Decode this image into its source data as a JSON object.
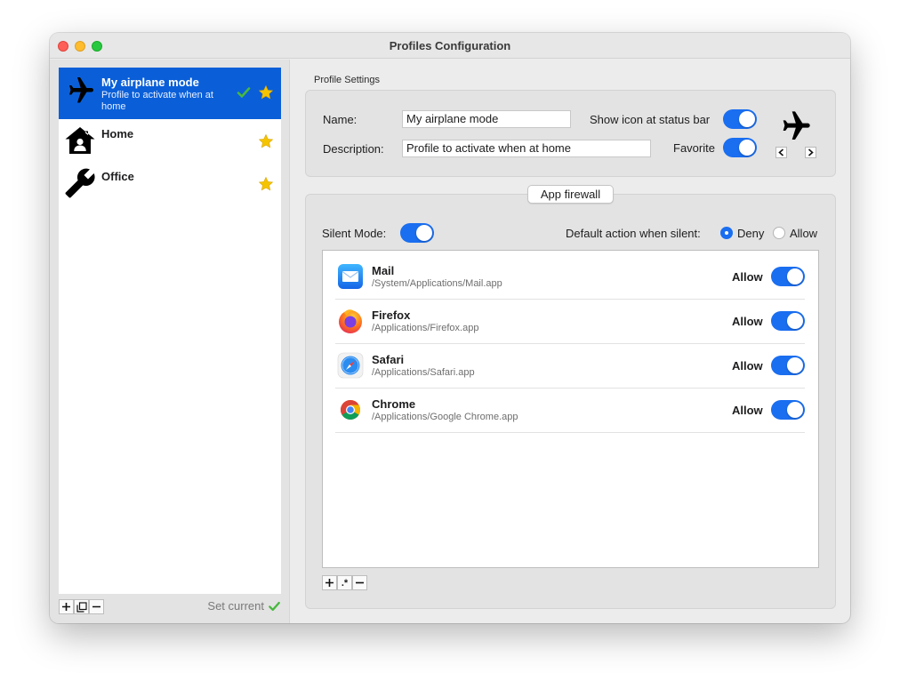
{
  "window": {
    "title": "Profiles Configuration"
  },
  "sidebar": {
    "profiles": [
      {
        "name": "My airplane mode",
        "description": "Profile to activate when at home",
        "icon": "airplane-icon",
        "selected": true,
        "current": true,
        "favorite": true
      },
      {
        "name": "Home",
        "description": "",
        "icon": "home-icon",
        "selected": false,
        "current": false,
        "favorite": true
      },
      {
        "name": "Office",
        "description": "",
        "icon": "wrench-icon",
        "selected": false,
        "current": false,
        "favorite": true
      }
    ],
    "footer": {
      "add": "+",
      "duplicate": "duplicate-icon",
      "remove": "−",
      "set_current": "Set current"
    }
  },
  "settings": {
    "group_label": "Profile Settings",
    "name_label": "Name:",
    "name_value": "My airplane mode",
    "description_label": "Description:",
    "description_value": "Profile to activate when at home",
    "show_icon_label": "Show icon at status bar",
    "show_icon_on": true,
    "favorite_label": "Favorite",
    "favorite_on": true,
    "icon": "airplane-icon"
  },
  "firewall": {
    "tab_label": "App firewall",
    "silent_label": "Silent Mode:",
    "silent_on": true,
    "default_action_label": "Default action when silent:",
    "deny_label": "Deny",
    "allow_label": "Allow",
    "default_action": "Deny",
    "apps": [
      {
        "name": "Mail",
        "path": "/System/Applications/Mail.app",
        "action": "Allow",
        "enabled": true,
        "icon": "mail-app-icon"
      },
      {
        "name": "Firefox",
        "path": "/Applications/Firefox.app",
        "action": "Allow",
        "enabled": true,
        "icon": "firefox-app-icon"
      },
      {
        "name": "Safari",
        "path": "/Applications/Safari.app",
        "action": "Allow",
        "enabled": true,
        "icon": "safari-app-icon"
      },
      {
        "name": "Chrome",
        "path": "/Applications/Google Chrome.app",
        "action": "Allow",
        "enabled": true,
        "icon": "chrome-app-icon"
      }
    ],
    "list_footer": {
      "add": "+",
      "regex": ".*",
      "remove": "−"
    }
  },
  "colors": {
    "accent": "#1a6ef0",
    "selection": "#0a5fd8",
    "check": "#49b83f",
    "star": "#f5c400"
  }
}
